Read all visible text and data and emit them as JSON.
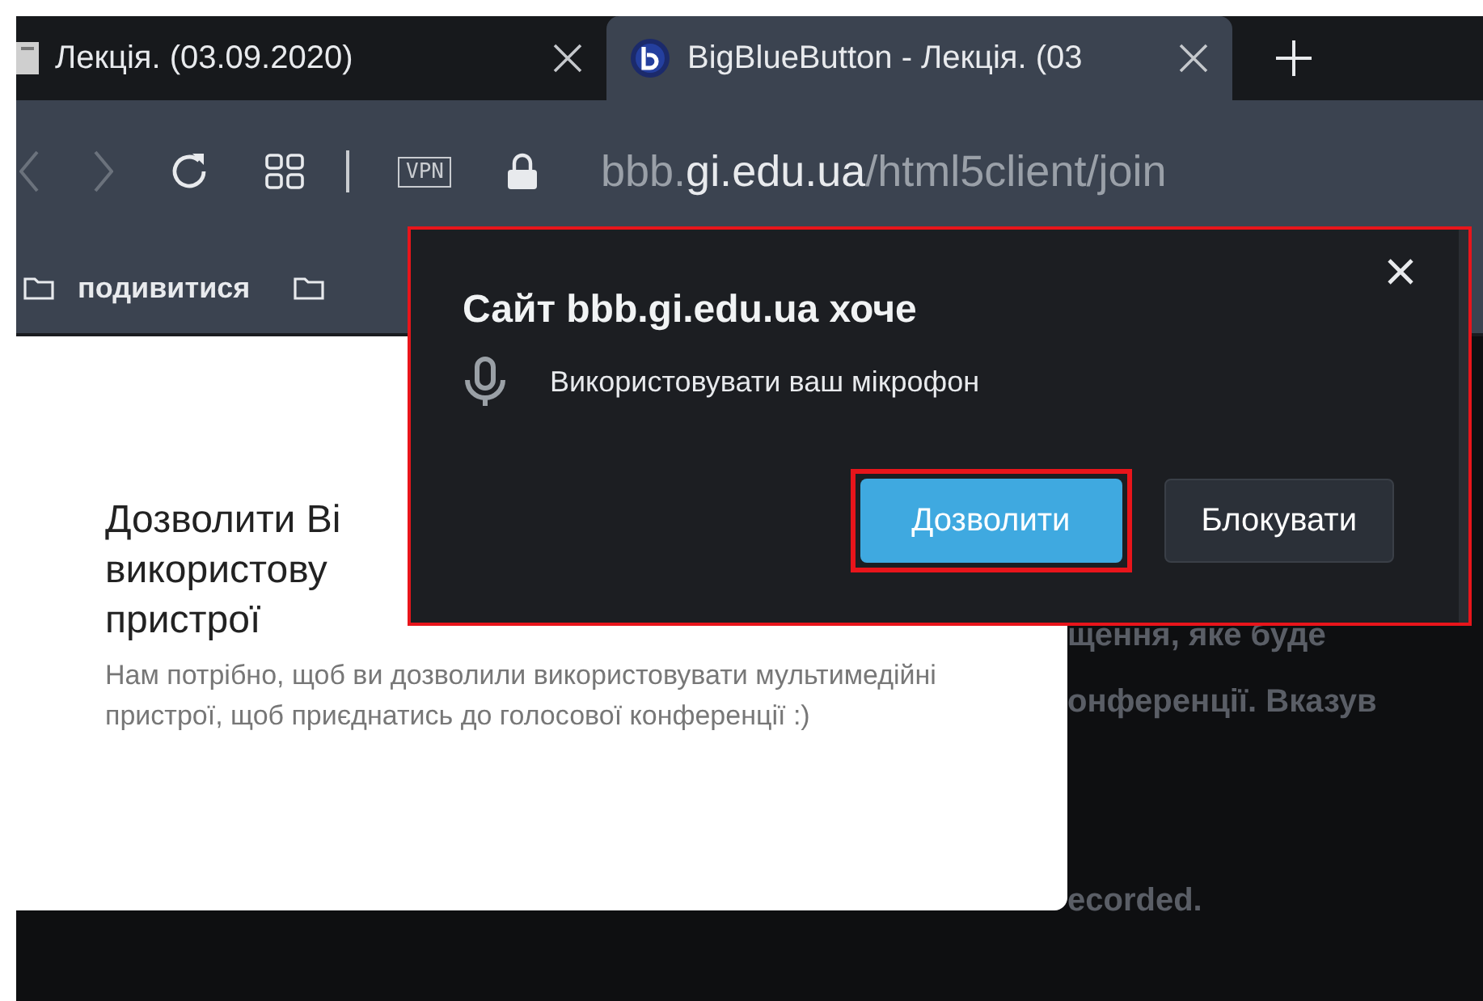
{
  "tabs": [
    {
      "title": "Лекція. (03.09.2020)",
      "selected": false
    },
    {
      "title": "BigBlueButton - Лекція. (03",
      "selected": true
    }
  ],
  "toolbar": {
    "vpn_badge": "VPN",
    "url_host": "bbb.",
    "url_domain": "gi.edu.ua",
    "url_path": "/html5client/join"
  },
  "bookmarks": [
    {
      "kind": "folder",
      "label": "подивитися"
    },
    {
      "kind": "folder"
    }
  ],
  "dialog": {
    "title_lines": [
      "Дозволити Ві",
      "використову",
      "пристрої"
    ],
    "description": "Нам потрібно, щоб ви дозволили використовувати мультимедійні пристрої, щоб приєднатись до голосової конференції :)"
  },
  "background_texts": [
    "щення, яке буде",
    "онференції. Вказув",
    "ecorded."
  ],
  "permission_prompt": {
    "title": "Сайт bbb.gi.edu.ua хоче",
    "request": "Використовувати ваш мікрофон",
    "highlighted": true,
    "buttons": [
      {
        "label": "Дозволити",
        "kind": "primary",
        "highlighted": true
      },
      {
        "label": "Блокувати",
        "kind": "secondary",
        "highlighted": false
      }
    ]
  }
}
